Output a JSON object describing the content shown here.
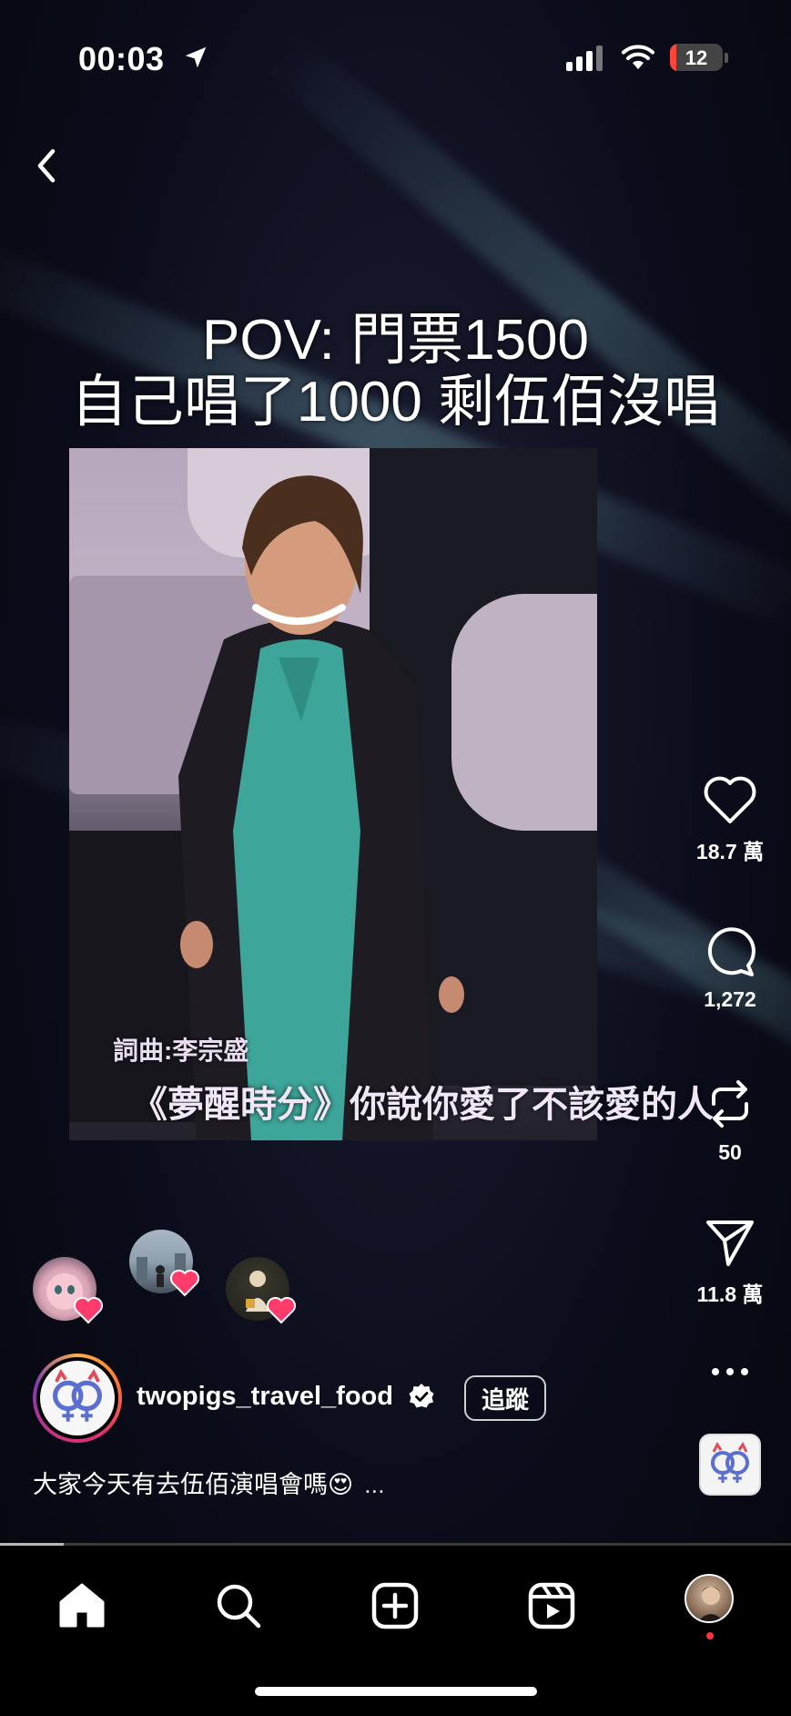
{
  "status_bar": {
    "time": "00:03",
    "battery_level": "12",
    "battery_color": "#ff453a"
  },
  "video": {
    "caption_line1": "POV: 門票1500",
    "caption_line2": "自己唱了1000 剩伍佰沒唱",
    "lyric_credit": "詞曲:李宗盛",
    "lyric_line": "《夢醒時分》你說你愛了不該愛的人",
    "progress_fraction": 0.08
  },
  "actions": {
    "likes": "18.7 萬",
    "comments": "1,272",
    "reposts": "50",
    "shares": "11.8 萬"
  },
  "post": {
    "username": "twopigs_travel_food",
    "verified_icon": "verified-badge-icon",
    "follow_label": "追蹤",
    "caption": "大家今天有去伍佰演唱會嗎😍",
    "caption_more": "..."
  },
  "nav": {
    "items": [
      "home-icon",
      "search-icon",
      "create-icon",
      "reels-icon",
      "profile-avatar"
    ],
    "accent": "#ff3040"
  },
  "likers": [
    "liker-avatar-1",
    "liker-avatar-2",
    "liker-avatar-3"
  ]
}
